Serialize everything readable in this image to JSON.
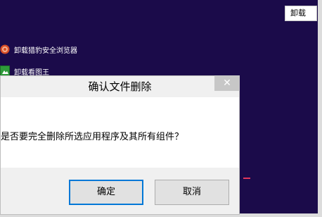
{
  "search": {
    "value": "卸载"
  },
  "apps": [
    {
      "label": "卸载猎豹安全浏览器",
      "icon": "cheetah-browser-icon"
    },
    {
      "label": "卸载看图王",
      "icon": "image-viewer-icon"
    }
  ],
  "dialog": {
    "title": "确认文件删除",
    "message": "是否要完全删除所选应用程序及其所有组件？",
    "close_label": "✕",
    "ok_label": "确定",
    "cancel_label": "取消"
  },
  "colors": {
    "desktop": "#1b0b4a",
    "accent": "#0078d7",
    "close": "#c7c7c7"
  }
}
